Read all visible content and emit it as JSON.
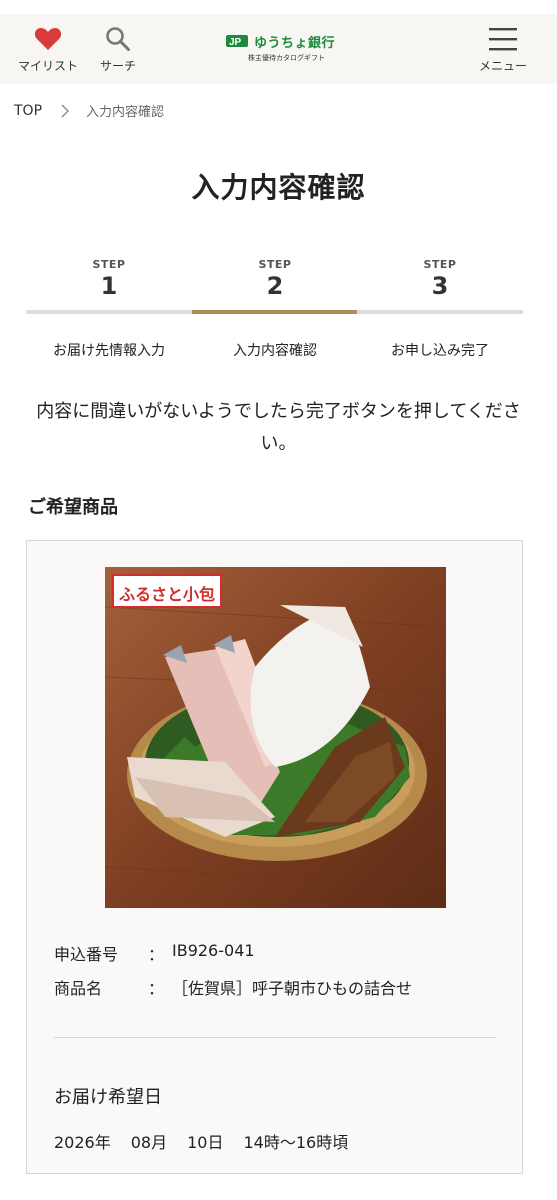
{
  "header": {
    "mylist_label": "マイリスト",
    "search_label": "サーチ",
    "menu_label": "メニュー",
    "logo_name": "ゆうちょ銀行",
    "logo_sub": "株主優待カタログギフト"
  },
  "breadcrumb": {
    "top": "TOP",
    "current": "入力内容確認"
  },
  "page_title": "入力内容確認",
  "steps": [
    {
      "word": "STEP",
      "number": "1",
      "label": "お届け先情報入力",
      "active": false
    },
    {
      "word": "STEP",
      "number": "2",
      "label": "入力内容確認",
      "active": true
    },
    {
      "word": "STEP",
      "number": "3",
      "label": "お申し込み完了",
      "active": false
    }
  ],
  "notice": "内容に間違いがないようでしたら完了ボタンを押してください。",
  "product_section": {
    "heading": "ご希望商品",
    "image_logo_text": "ふるさと小包",
    "application_number_label": "申込番号",
    "application_number": "IB926-041",
    "product_name_label": "商品名",
    "product_name": "［佐賀県］呼子朝市ひもの詰合せ",
    "colon": "：",
    "delivery_heading": "お届け希望日",
    "delivery": {
      "year": "2026年",
      "month": "08月",
      "day": "10日",
      "time": "14時〜16時頃"
    }
  },
  "colors": {
    "accent": "#b08d56",
    "heart": "#d93a3a",
    "logo_green": "#1d8a3e",
    "step_bar": "#dddddd"
  },
  "icons": [
    "heart-icon",
    "search-icon",
    "hamburger-menu-icon",
    "chevron-right-icon"
  ]
}
